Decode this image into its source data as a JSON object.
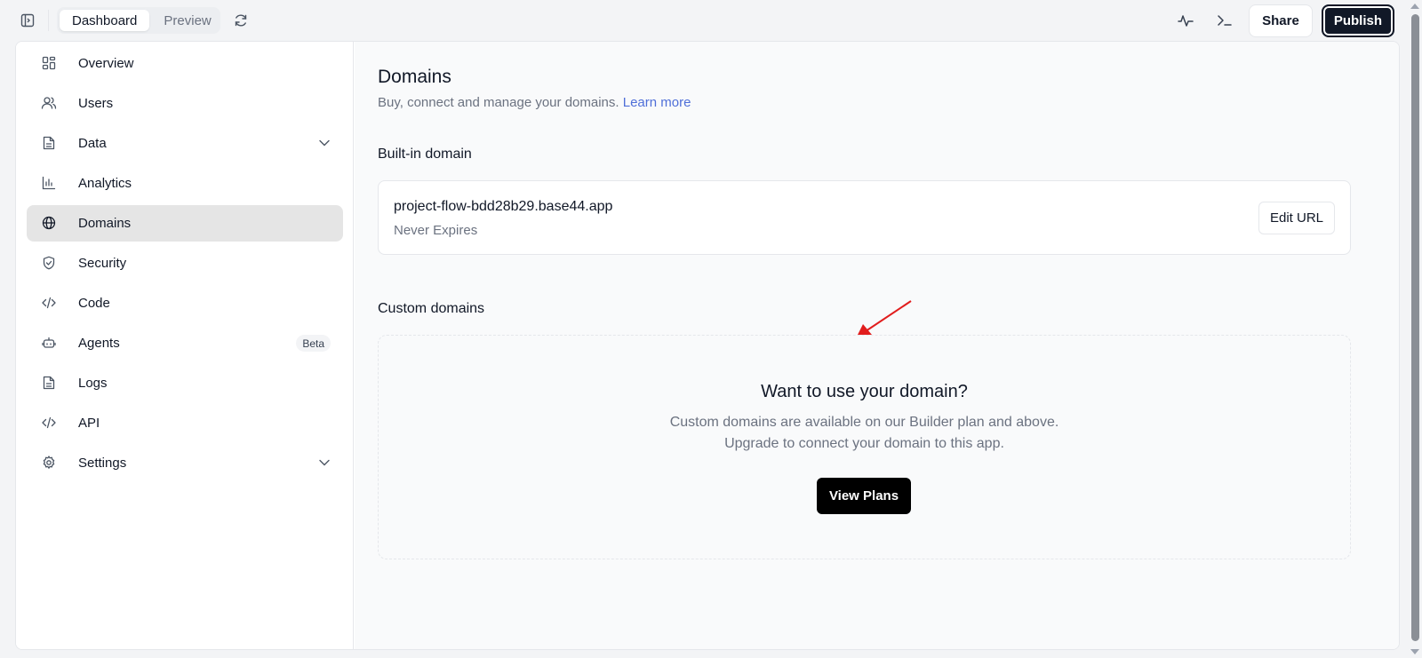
{
  "topbar": {
    "tabs": [
      {
        "label": "Dashboard",
        "active": true
      },
      {
        "label": "Preview",
        "active": false
      }
    ],
    "share_label": "Share",
    "publish_label": "Publish"
  },
  "sidebar": {
    "items": [
      {
        "label": "Overview",
        "icon": "grid-icon"
      },
      {
        "label": "Users",
        "icon": "users-icon"
      },
      {
        "label": "Data",
        "icon": "file-icon",
        "chevron": true
      },
      {
        "label": "Analytics",
        "icon": "bar-chart-icon"
      },
      {
        "label": "Domains",
        "icon": "globe-icon",
        "active": true
      },
      {
        "label": "Security",
        "icon": "shield-icon"
      },
      {
        "label": "Code",
        "icon": "code-icon"
      },
      {
        "label": "Agents",
        "icon": "bot-icon",
        "badge": "Beta"
      },
      {
        "label": "Logs",
        "icon": "file-icon"
      },
      {
        "label": "API",
        "icon": "code-icon"
      },
      {
        "label": "Settings",
        "icon": "gear-icon",
        "chevron": true
      }
    ]
  },
  "main": {
    "title": "Domains",
    "subtitle": "Buy, connect and manage your domains.",
    "learn_more": "Learn more",
    "builtin_title": "Built-in domain",
    "domain_name": "project-flow-bdd28b29.base44.app",
    "domain_expiry": "Never Expires",
    "edit_url_label": "Edit URL",
    "custom_title": "Custom domains",
    "cta_title": "Want to use your domain?",
    "cta_line1": "Custom domains are available on our Builder plan and above.",
    "cta_line2": "Upgrade to connect your domain to this app.",
    "view_plans_label": "View Plans"
  },
  "colors": {
    "accent_link": "#4f6fd8",
    "annotation_arrow": "#e11d1d",
    "primary_button": "#000000"
  }
}
